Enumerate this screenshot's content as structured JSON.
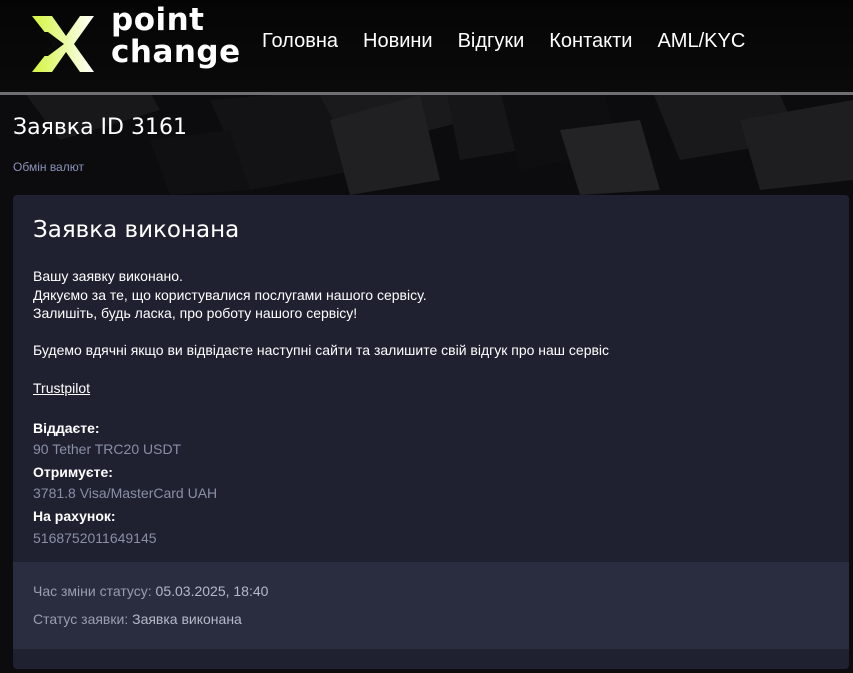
{
  "header": {
    "logo_line1": "point",
    "logo_line2": "change",
    "nav": [
      "Головна",
      "Новини",
      "Відгуки",
      "Контакти",
      "AML/KYC"
    ]
  },
  "page": {
    "title": "Заявка ID 3161",
    "breadcrumb": "Обмін валют"
  },
  "card": {
    "title": "Заявка виконана",
    "message_lines": [
      "Вашу заявку виконано.",
      "Дякуємо за те, що користувалися послугами нашого сервісу.",
      "Залишіть, будь ласка, про роботу нашого сервісу!"
    ],
    "thanks": "Будемо вдячні якщо ви відвідаєте наступні сайти та залишите свій відгук про наш сервіс",
    "trustpilot": "Trustpilot",
    "give_label": "Віддаєте:",
    "give_value": "90 Tether TRC20 USDT",
    "receive_label": "Отримуєте:",
    "receive_value": "3781.8 Visa/MasterCard UAH",
    "account_label": "На рахунок:",
    "account_value": "5168752011649145",
    "status_time_label": "Час зміни статусу:",
    "status_time_value": "05.03.2025, 18:40",
    "status_label": "Статус заявки:",
    "status_value": "Заявка виконана"
  },
  "colors": {
    "accent": "#d4f53c",
    "card_bg": "#1f2130",
    "status_bg": "#2a2d3f"
  }
}
